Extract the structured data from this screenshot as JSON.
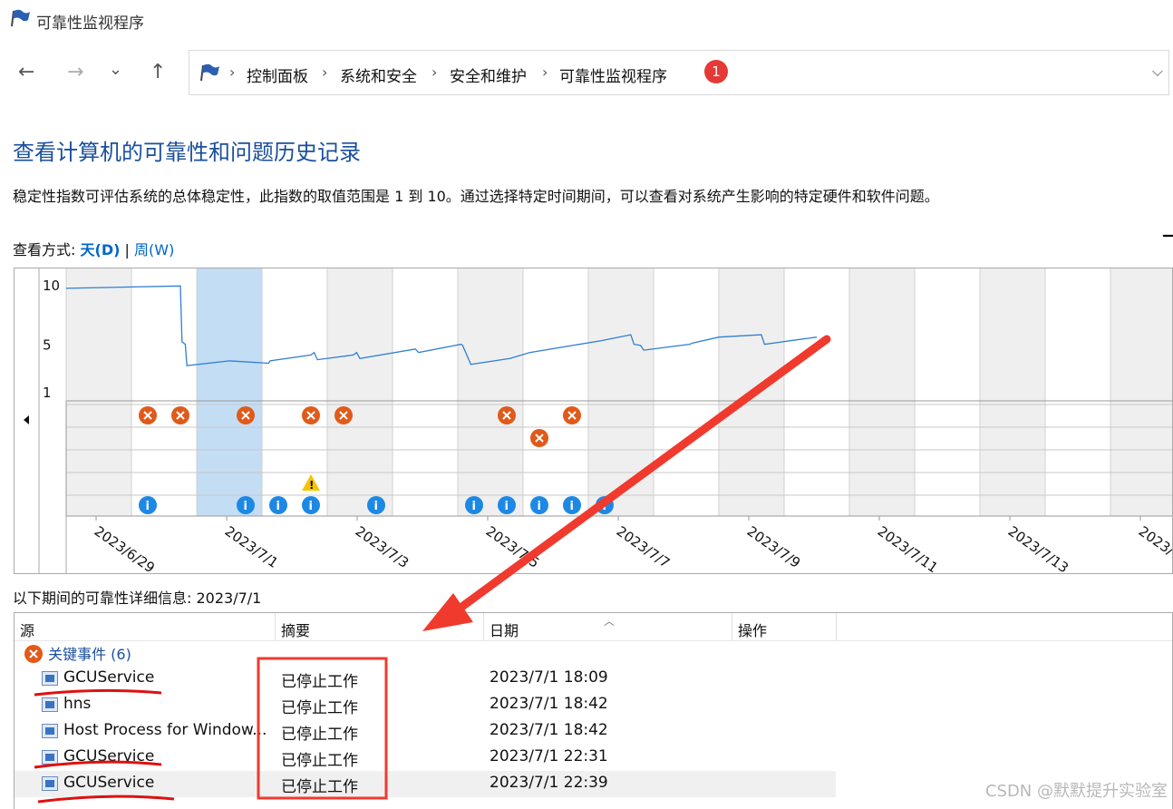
{
  "window": {
    "title": "可靠性监视程序"
  },
  "nav": {
    "back": "←",
    "forward": "→",
    "recent": "⌄",
    "up": "↑"
  },
  "breadcrumb": [
    "控制面板",
    "系统和安全",
    "安全和维护",
    "可靠性监视程序"
  ],
  "breadcrumb_separator": "›",
  "annotation_badge": "1",
  "page": {
    "heading": "查看计算机的可靠性和问题历史记录",
    "description": "稳定性指数可评估系统的总体稳定性，此指数的取值范围是 1 到 10。通过选择特定时间期间，可以查看对系统产生影响的特定硬件和软件问题。",
    "view_by_label": "查看方式:",
    "view_day": "天(D)",
    "view_separator": "|",
    "view_week": "周(W)"
  },
  "chart_data": {
    "type": "line",
    "y_ticks": [
      "10",
      "5",
      "1"
    ],
    "ylim": [
      1,
      10
    ],
    "x_labels": [
      "2023/6/29",
      "2023/7/1",
      "2023/7/3",
      "2023/7/5",
      "2023/7/7",
      "2023/7/9",
      "2023/7/11",
      "2023/7/13",
      "2023/7/15"
    ],
    "selected_date": "2023/7/1",
    "stability_index": [
      [
        0,
        9.7
      ],
      [
        3.5,
        9.9
      ],
      [
        3.55,
        5.2
      ],
      [
        3.65,
        5.0
      ],
      [
        3.7,
        3.2
      ],
      [
        5.0,
        3.6
      ],
      [
        6.2,
        3.4
      ],
      [
        6.25,
        3.6
      ],
      [
        7.5,
        4.1
      ],
      [
        7.6,
        4.3
      ],
      [
        7.7,
        3.7
      ],
      [
        8.8,
        4.1
      ],
      [
        8.9,
        4.3
      ],
      [
        9.0,
        3.8
      ],
      [
        10.7,
        4.6
      ],
      [
        10.8,
        4.3
      ],
      [
        12.1,
        5.0
      ],
      [
        12.15,
        4.9
      ],
      [
        12.4,
        3.3
      ],
      [
        13.6,
        3.8
      ],
      [
        14.2,
        4.3
      ],
      [
        16.4,
        5.3
      ],
      [
        17.3,
        5.8
      ],
      [
        17.4,
        5.0
      ],
      [
        17.6,
        4.9
      ],
      [
        17.7,
        4.5
      ],
      [
        19.1,
        5.0
      ],
      [
        19.2,
        5.1
      ],
      [
        20.0,
        5.6
      ],
      [
        21.3,
        5.8
      ],
      [
        21.4,
        5.0
      ],
      [
        23.0,
        5.6
      ]
    ],
    "critical_events_day": [
      2.5,
      3.5,
      5.5,
      7.5,
      8.5,
      13.5,
      15.5
    ],
    "critical_events_row2_day": [
      14.5
    ],
    "warning_events_day": [
      7.5
    ],
    "info_events_day": [
      2.5,
      5.5,
      6.5,
      7.5,
      9.5,
      12.5,
      13.5,
      14.5,
      15.5,
      16.5
    ],
    "colors": {
      "line": "#2f7fd3",
      "selected": "#c3ddf4",
      "critical": "#e05a1a",
      "info": "#1e88e5",
      "warning": "#f5c400"
    }
  },
  "details": {
    "title": "以下期间的可靠性详细信息: 2023/7/1",
    "columns": [
      "源",
      "摘要",
      "日期",
      "操作"
    ],
    "group": "关键事件 (6)",
    "rows": [
      {
        "source": "GCUService",
        "summary": "已停止工作",
        "date": "2023/7/1 18:09"
      },
      {
        "source": "hns",
        "summary": "已停止工作",
        "date": "2023/7/1 18:42"
      },
      {
        "source": "Host Process for Window...",
        "summary": "已停止工作",
        "date": "2023/7/1 18:42"
      },
      {
        "source": "GCUService",
        "summary": "已停止工作",
        "date": "2023/7/1 22:31"
      },
      {
        "source": "GCUService",
        "summary": "已停止工作",
        "date": "2023/7/1 22:39"
      }
    ]
  },
  "watermark": "CSDN @默默提升实验室"
}
